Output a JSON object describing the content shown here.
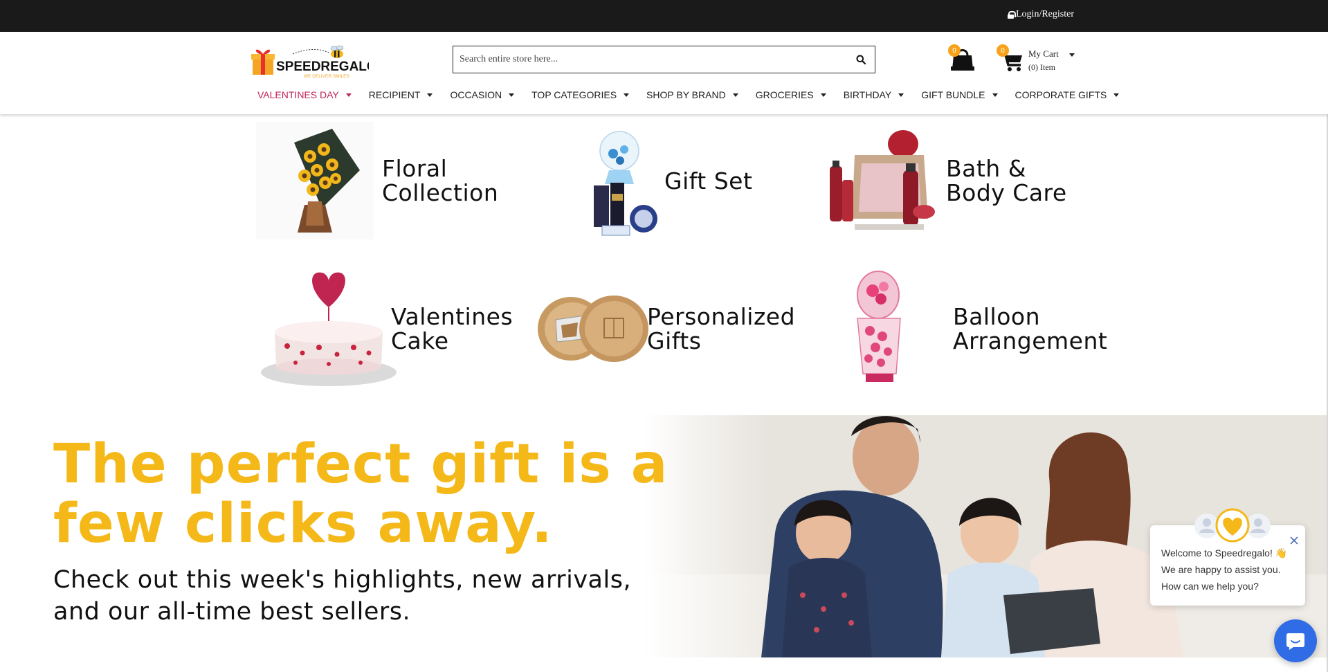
{
  "topbar": {
    "login_label": "Login/Register"
  },
  "brand": {
    "name": "SPEEDREGALO",
    "tagline": "WE DELIVER SMILES",
    "accent": "#f5b819",
    "nav_active_color": "#c0245a"
  },
  "search": {
    "placeholder": "Search entire store here...",
    "value": ""
  },
  "wishlist": {
    "count": "0"
  },
  "cart": {
    "count": "0",
    "title": "My Cart",
    "items": "(0) Item"
  },
  "nav": [
    {
      "label": "VALENTINES DAY",
      "active": true
    },
    {
      "label": "RECIPIENT"
    },
    {
      "label": "OCCASION"
    },
    {
      "label": "TOP CATEGORIES"
    },
    {
      "label": "SHOP BY BRAND"
    },
    {
      "label": "GROCERIES"
    },
    {
      "label": "BIRTHDAY"
    },
    {
      "label": "GIFT BUNDLE"
    },
    {
      "label": "CORPORATE GIFTS"
    }
  ],
  "categories": [
    {
      "label": "Floral\nCollection",
      "icon": "sunflower-bouquet-image"
    },
    {
      "label": "Gift Set",
      "icon": "gift-set-image"
    },
    {
      "label": "Bath &\nBody Care",
      "icon": "bath-products-image"
    },
    {
      "label": "Valentines\nCake",
      "icon": "heart-cake-image"
    },
    {
      "label": "Personalized\nGifts",
      "icon": "cheese-board-image"
    },
    {
      "label": "Balloon\nArrangement",
      "icon": "balloon-arrangement-image"
    }
  ],
  "hero": {
    "title": "The perfect gift is a few clicks away.",
    "subtitle": "Check out this week's highlights, new arrivals, and our all-time best sellers."
  },
  "chat": {
    "message": "Welcome to Speedregalo! 👋 We are happy to assist you. How can we help you?",
    "button_color": "#2f6ce5"
  }
}
